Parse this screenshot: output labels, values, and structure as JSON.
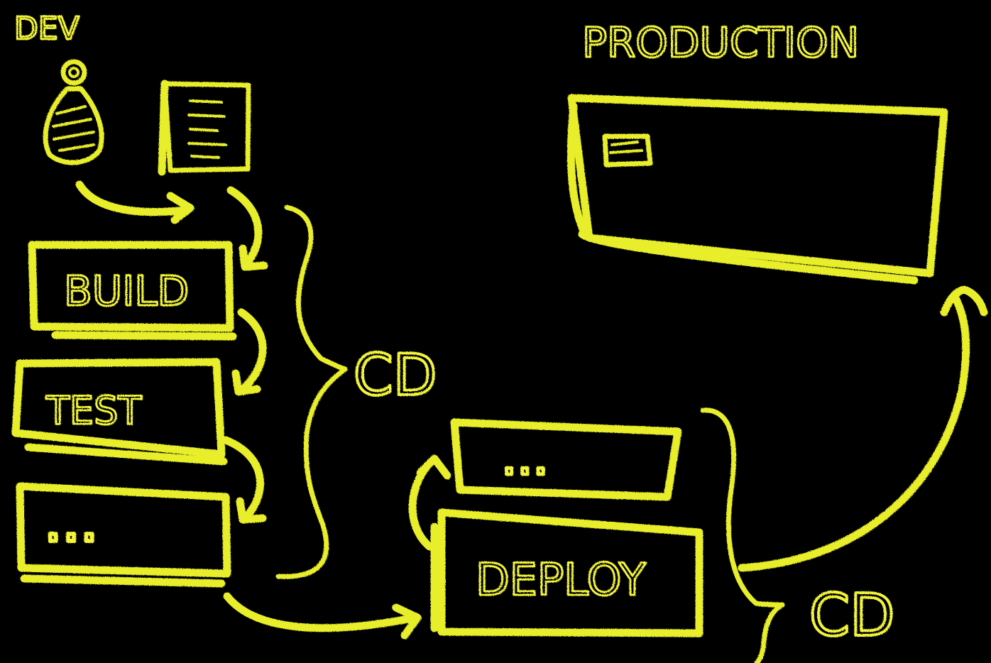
{
  "theme": {
    "background": "#000000",
    "chalk": "#e8ee2a",
    "chalk_text": "#f2f53a"
  },
  "labels": {
    "dev": "DEV",
    "production": "PRODUCTION",
    "build": "BUILD",
    "test": "TEST",
    "stage_more": "...",
    "deploy": "DEPLOY",
    "deploy_more": "...",
    "cd_main": "CD",
    "cd_deploy": "CD"
  },
  "icons": {
    "developer": "person-icon",
    "code": "document-icon",
    "app": "window-icon"
  }
}
